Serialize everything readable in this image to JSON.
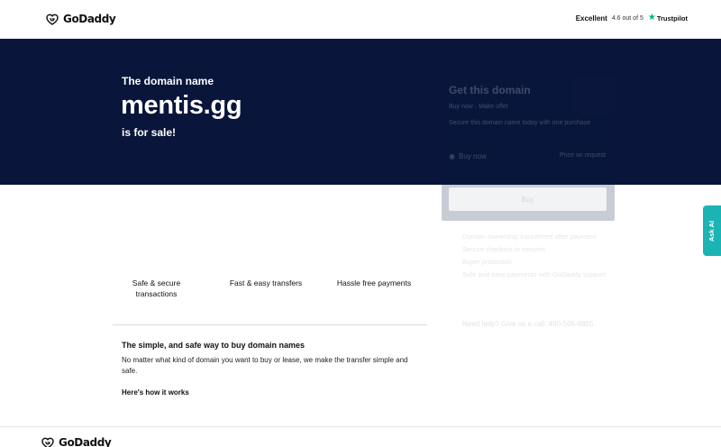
{
  "header": {
    "logo_text": "GoDaddy",
    "rating_label": "Excellent",
    "rating_score": "4.6 out of 5",
    "trustpilot": "Trustpilot"
  },
  "hero": {
    "kicker": "The domain name",
    "domain": "mentis.gg",
    "sale_text": "is for sale!"
  },
  "card": {
    "title": "Get this domain",
    "subtitle": "Buy now  ·  Make offer",
    "description": "Secure this domain name today with one purchase",
    "option_label": "Buy now",
    "price": "Price on request",
    "button_label": "Buy",
    "info_lines": [
      "Domain ownership transferred after payment",
      "Secure checkout in minutes",
      "Buyer protection",
      "Safe and easy payments with GoDaddy support"
    ],
    "help_text": "Need help? Give us a call: 480-505-8855"
  },
  "benefits": [
    {
      "line1": "Safe & secure",
      "line2": "transactions"
    },
    {
      "line1": "Fast & easy transfers",
      "line2": ""
    },
    {
      "line1": "Hassle free payments",
      "line2": ""
    }
  ],
  "info": {
    "title": "The simple, and safe way to buy domain names",
    "body": "No matter what kind of domain you want to buy or lease, we make the transfer simple and safe.",
    "how_it_works": "Here's how it works"
  },
  "ask_ai": {
    "label": "Ask AI"
  },
  "footer": {
    "logo_text": "GoDaddy"
  },
  "colors": {
    "hero_bg": "#09153a",
    "ask_ai": "#1bb3b3",
    "trustpilot_star": "#00b67a"
  }
}
